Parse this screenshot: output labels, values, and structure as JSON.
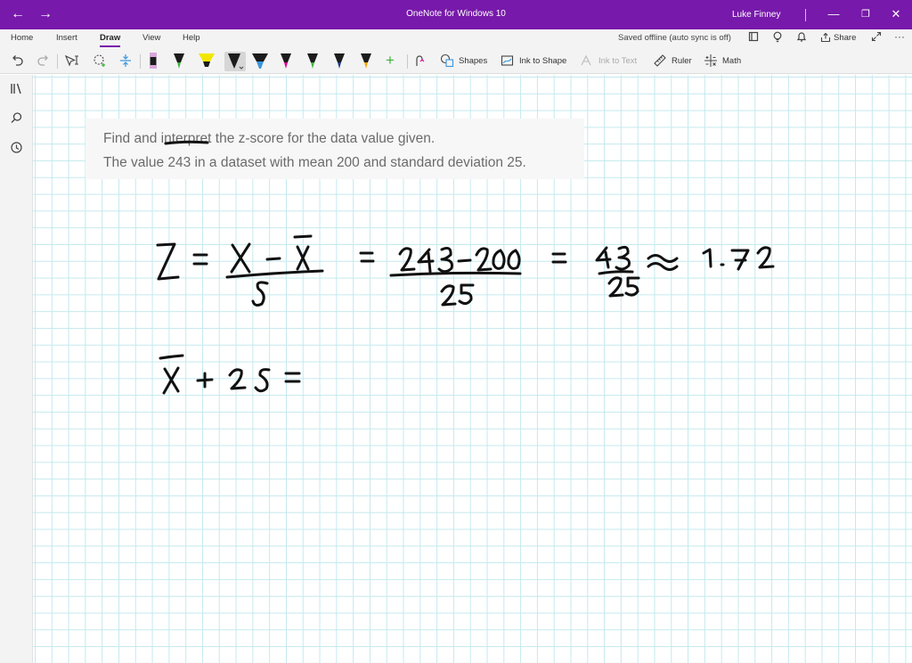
{
  "titlebar": {
    "back_glyph": "←",
    "forward_glyph": "→",
    "title": "OneNote for Windows 10",
    "user": "Luke Finney",
    "min_glyph": "—",
    "max_glyph": "❐",
    "close_glyph": "✕",
    "accent": "#7719aa"
  },
  "menu": {
    "tabs": [
      "Home",
      "Insert",
      "Draw",
      "View",
      "Help"
    ],
    "active_tab": "Draw",
    "sync_status": "Saved offline (auto sync is off)",
    "share_label": "Share",
    "more_glyph": "···"
  },
  "toolbar": {
    "shapes_label": "Shapes",
    "ink_to_shape_label": "Ink to Shape",
    "ink_to_text_label": "Ink to Text",
    "ruler_label": "Ruler",
    "math_label": "Math",
    "pens": [
      {
        "name": "pen-pink",
        "color": "#d9a6d9"
      },
      {
        "name": "pen-black-green",
        "color": "#1c1c1c"
      },
      {
        "name": "highlighter-yellow",
        "color": "#f2e600"
      },
      {
        "name": "pen-black",
        "color": "#1c1c1c"
      },
      {
        "name": "pen-blue",
        "color": "#3a96dd"
      },
      {
        "name": "pen-magenta",
        "color": "#e3008c"
      },
      {
        "name": "pen-green",
        "color": "#3bb33b"
      },
      {
        "name": "pen-dark-blue",
        "color": "#1b3c8c"
      },
      {
        "name": "pen-orange",
        "color": "#f7a800"
      }
    ]
  },
  "problem": {
    "line1": "Find and interpret the z-score for the data value given.",
    "line2": "The value 243 in a dataset with mean 200 and standard deviation 25."
  }
}
